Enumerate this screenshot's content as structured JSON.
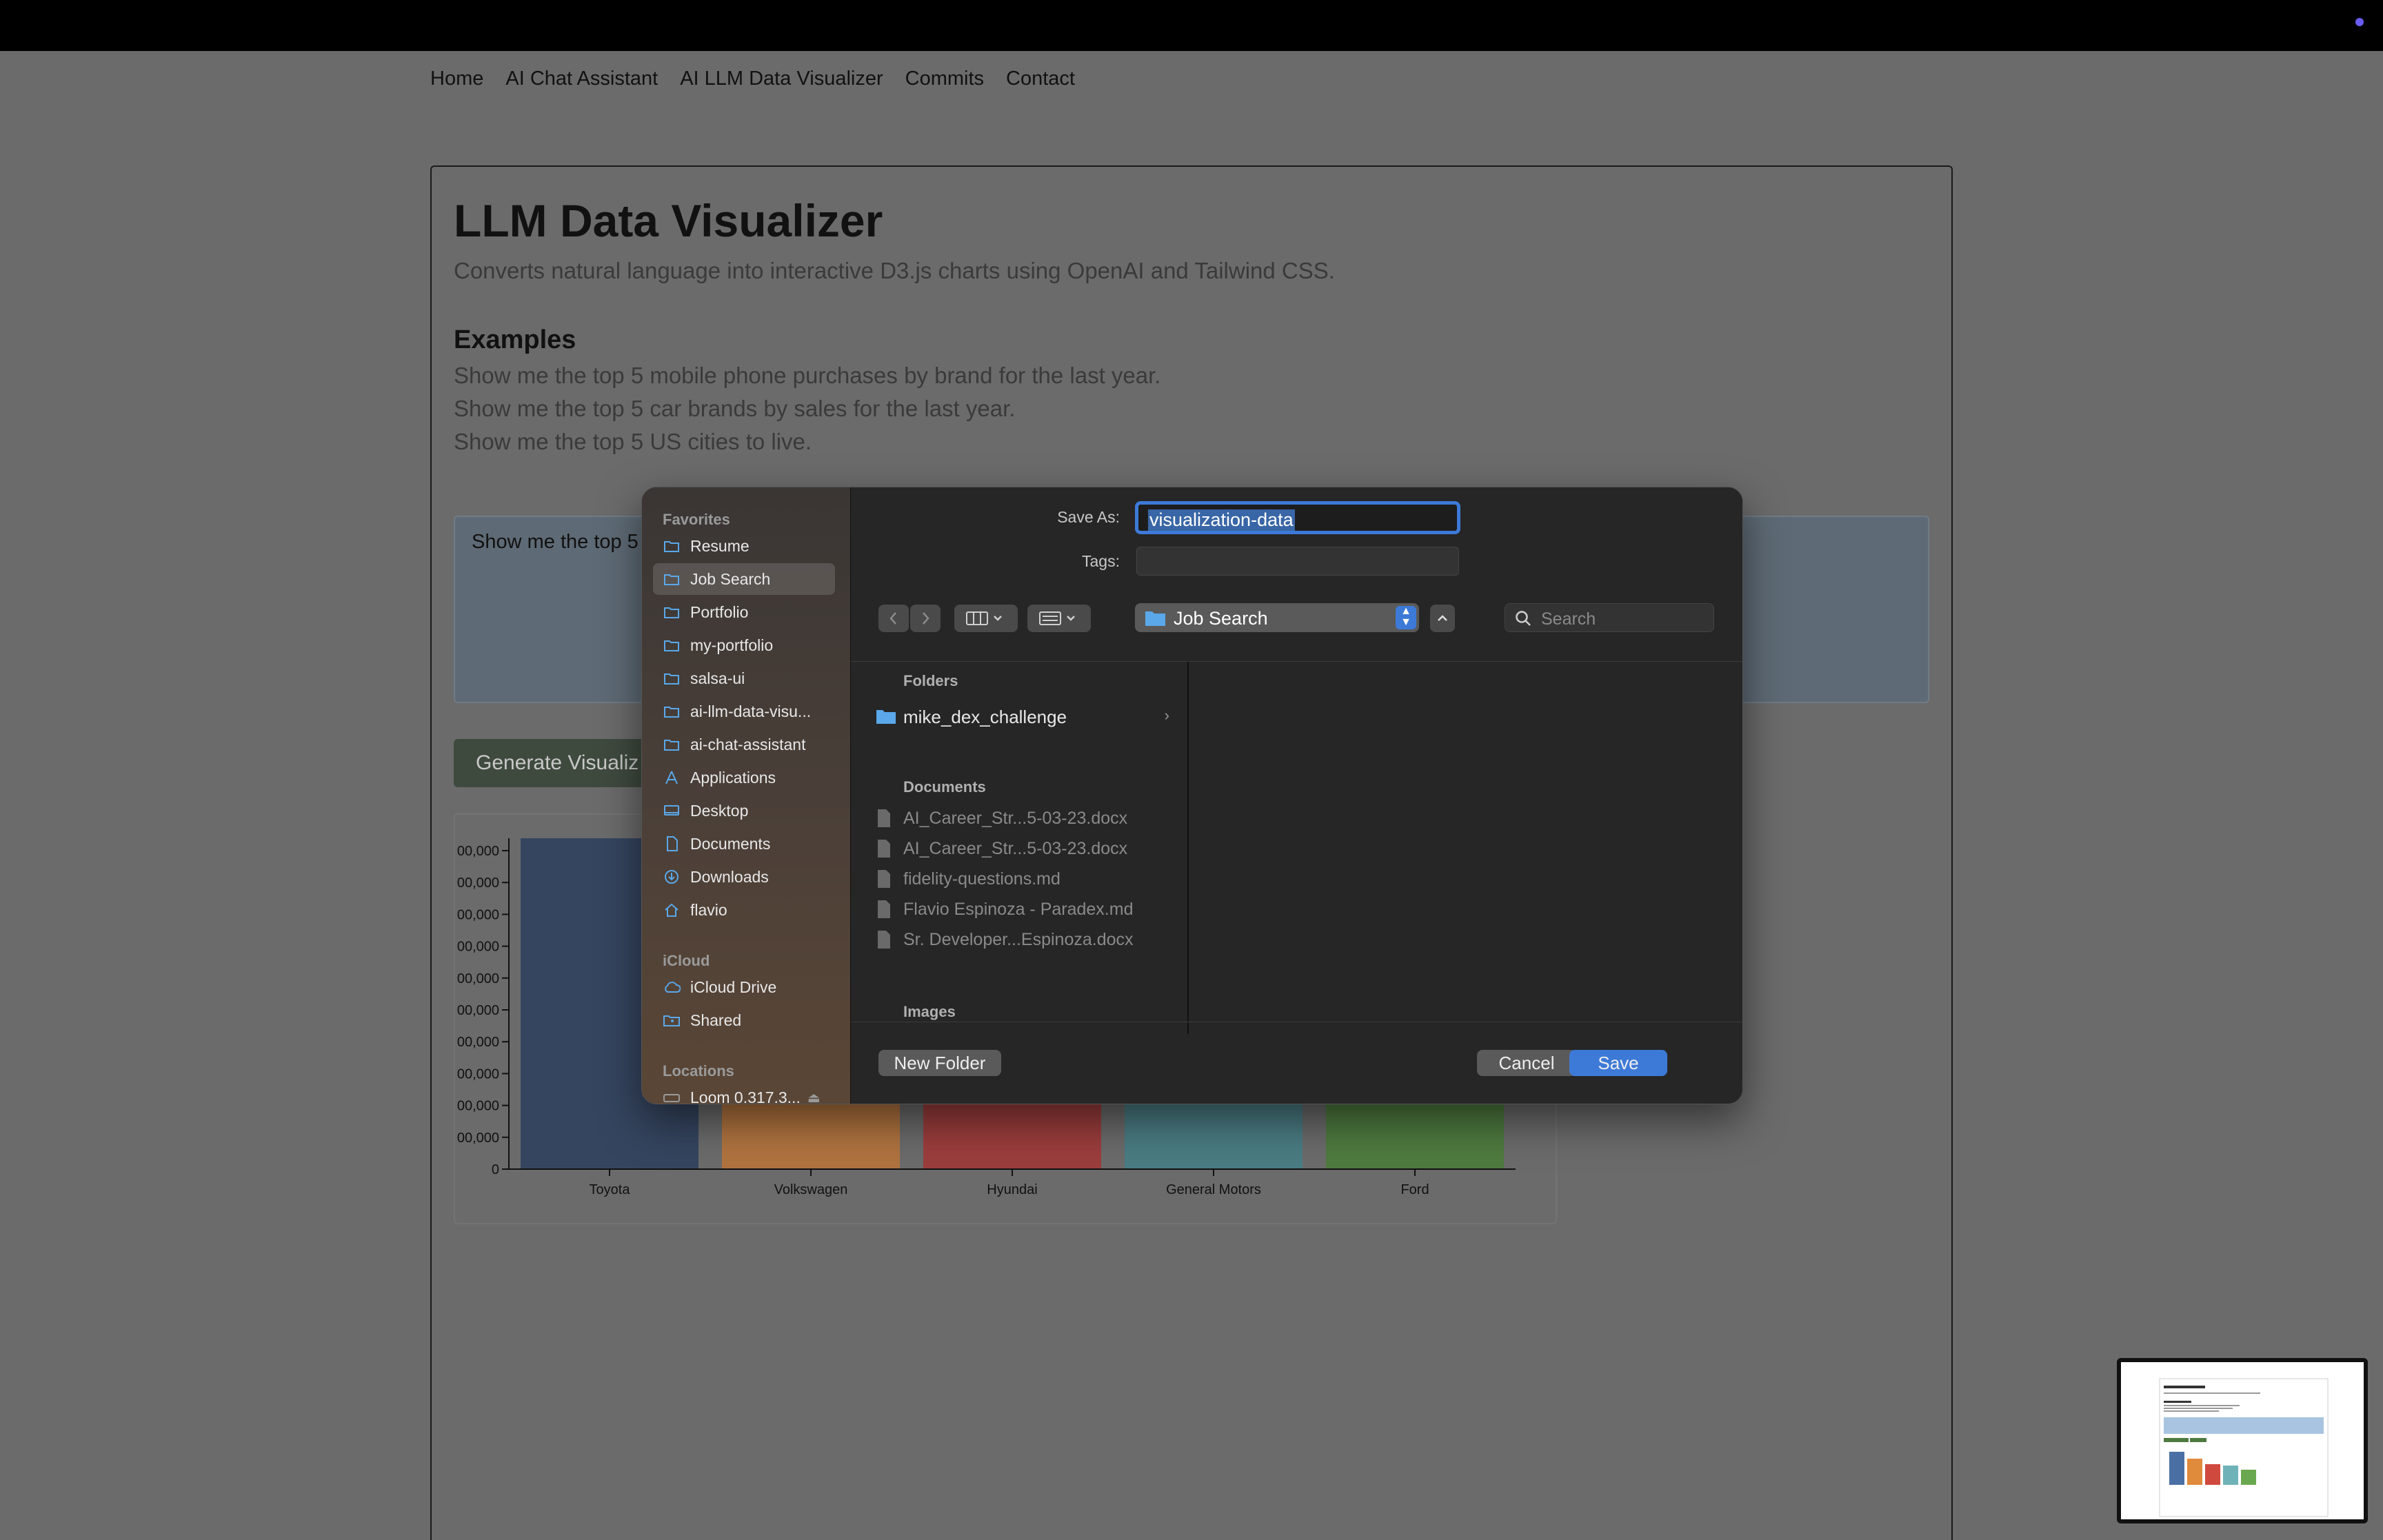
{
  "nav": [
    "Home",
    "AI Chat Assistant",
    "AI LLM Data Visualizer",
    "Commits",
    "Contact"
  ],
  "page": {
    "title": "LLM Data Visualizer",
    "subtitle": "Converts natural language into interactive D3.js charts using OpenAI and Tailwind CSS.",
    "examples_heading": "Examples",
    "examples": [
      "Show me the top 5 mobile phone purchases by brand for the last year.",
      "Show me the top 5 car brands by sales for the last year.",
      "Show me the top 5 US cities to live."
    ],
    "prompt_visible": "Show me the top 5",
    "generate_button": "Generate Visualiz"
  },
  "chart_data": {
    "type": "bar",
    "categories": [
      "Toyota",
      "Volkswagen",
      "Hyundai",
      "General Motors",
      "Ford"
    ],
    "colors": [
      "#35455f",
      "#b0733f",
      "#9b3d3d",
      "#4a7c83",
      "#4e7a3f"
    ],
    "ytick_labels": [
      "00,000",
      "00,000",
      "00,000",
      "00,000",
      "00,000",
      "00,000",
      "00,000",
      "00,000",
      "00,000",
      "00,000",
      "0"
    ]
  },
  "dialog": {
    "sidebar": {
      "favorites_label": "Favorites",
      "favorites": [
        {
          "label": "Resume",
          "icon": "folder-icon"
        },
        {
          "label": "Job Search",
          "icon": "folder-icon",
          "active": true
        },
        {
          "label": "Portfolio",
          "icon": "folder-icon"
        },
        {
          "label": "my-portfolio",
          "icon": "folder-icon"
        },
        {
          "label": "salsa-ui",
          "icon": "folder-icon"
        },
        {
          "label": "ai-llm-data-visu...",
          "icon": "folder-icon"
        },
        {
          "label": "ai-chat-assistant",
          "icon": "folder-icon"
        },
        {
          "label": "Applications",
          "icon": "applications-icon"
        },
        {
          "label": "Desktop",
          "icon": "desktop-icon"
        },
        {
          "label": "Documents",
          "icon": "document-icon"
        },
        {
          "label": "Downloads",
          "icon": "downloads-icon"
        },
        {
          "label": "flavio",
          "icon": "home-icon"
        }
      ],
      "icloud_label": "iCloud",
      "icloud": [
        {
          "label": "iCloud Drive",
          "icon": "cloud-icon"
        },
        {
          "label": "Shared",
          "icon": "shared-folder-icon"
        }
      ],
      "locations_label": "Locations",
      "locations": [
        {
          "label": "Loom 0.317.3...",
          "icon": "disk-icon"
        }
      ]
    },
    "save_as_label": "Save As:",
    "save_as_value": "visualization-data",
    "tags_label": "Tags:",
    "location": "Job Search",
    "search_placeholder": "Search",
    "folders_heading": "Folders",
    "folders": [
      "mike_dex_challenge"
    ],
    "documents_heading": "Documents",
    "documents": [
      "AI_Career_Str...5-03-23.docx",
      "AI_Career_Str...5-03-23.docx",
      "fidelity-questions.md",
      "Flavio Espinoza - Paradex.md",
      "Sr. Developer...Espinoza.docx"
    ],
    "images_heading": "Images",
    "new_folder_button": "New Folder",
    "cancel_button": "Cancel",
    "save_button": "Save",
    "accent": "#3d7ad8"
  }
}
